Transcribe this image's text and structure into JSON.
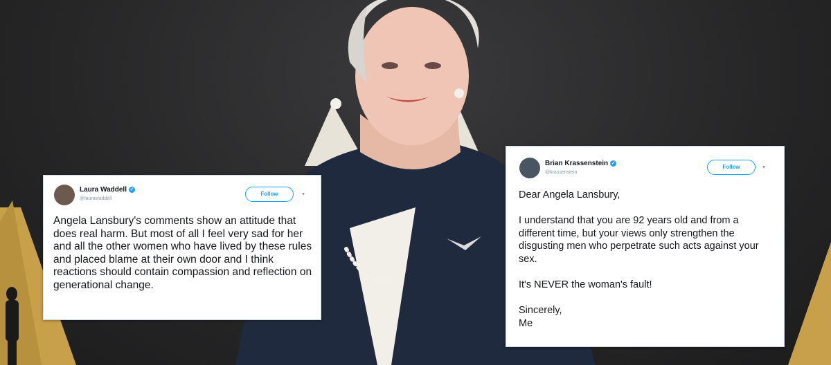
{
  "tweets": [
    {
      "name": "Laura Waddell",
      "handle": "@laurawaddell",
      "verified": true,
      "follow_label": "Follow",
      "body": "Angela Lansbury's comments show an attitude that does real harm. But most of all I feel very sad for her and all the other women who have lived by these rules and placed blame at their own door and I think reactions should contain compassion and reflection on generational change."
    },
    {
      "name": "Brian Krassenstein",
      "handle": "@krassenstein",
      "verified": true,
      "follow_label": "Follow",
      "body_paragraphs": [
        "Dear Angela Lansbury,",
        "I understand that you are 92 years old and from a different time, but your views only strengthen the disgusting men who perpetrate such acts against your sex.",
        "It's NEVER the woman's fault!",
        "Sincerely,\nMe"
      ]
    }
  ],
  "colors": {
    "twitter_blue": "#1da1f2",
    "backdrop": "#2b2b2c",
    "gold": "#c9a04a"
  },
  "icons": [
    "verified-badge-icon",
    "chevron-down-icon"
  ]
}
